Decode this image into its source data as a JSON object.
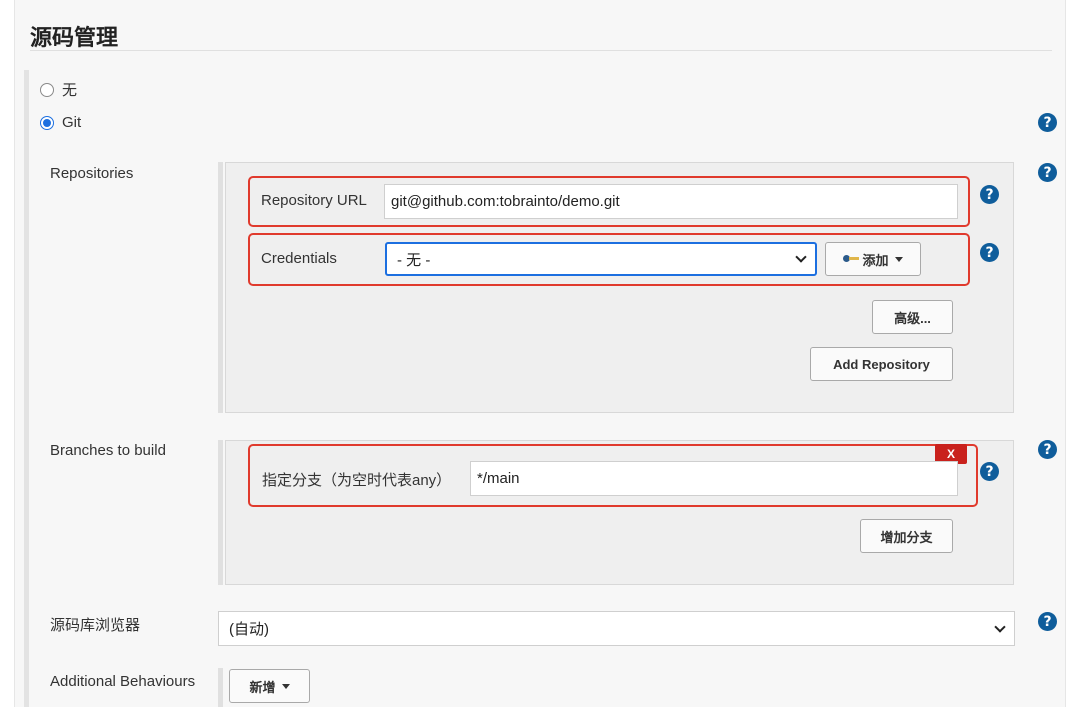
{
  "section": {
    "title": "源码管理"
  },
  "scm": {
    "options": [
      {
        "label": "无",
        "checked": false
      },
      {
        "label": "Git",
        "checked": true
      }
    ]
  },
  "repositories": {
    "label": "Repositories",
    "url_label": "Repository URL",
    "url_value": "git@github.com:tobrainto/demo.git",
    "credentials_label": "Credentials",
    "credentials_value": "- 无 -",
    "add_button": "添加",
    "advanced_button": "高级...",
    "add_repository_button": "Add Repository"
  },
  "branches": {
    "label": "Branches to build",
    "spec_label": "指定分支（为空时代表any）",
    "spec_value": "*/main",
    "delete_button": "X",
    "add_branch_button": "增加分支"
  },
  "browser": {
    "label": "源码库浏览器",
    "value": "(自动)"
  },
  "behaviours": {
    "label": "Additional Behaviours",
    "add_button": "新增"
  },
  "help_glyph": "?",
  "icons": [
    "help-icon",
    "key-icon",
    "caret-down-icon",
    "chevron-down-icon"
  ],
  "colors": {
    "help": "#0f5d9b",
    "highlight": "#e03a2d",
    "delete": "#c9211c",
    "focus": "#1c6fe0"
  }
}
